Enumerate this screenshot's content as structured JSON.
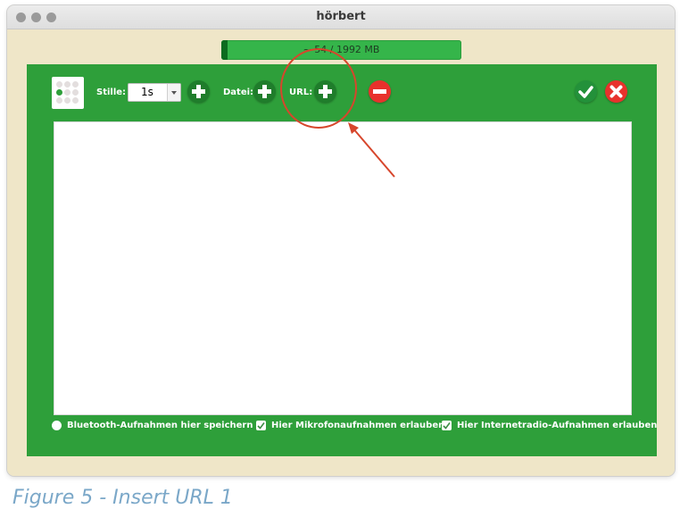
{
  "window": {
    "title": "hörbert"
  },
  "storage": {
    "label": "~ 54 / 1992 MB",
    "used_mb": 54,
    "total_mb": 1992
  },
  "toolbar": {
    "silence_label": "Stille:",
    "silence_value": "1s",
    "file_label": "Datei:",
    "url_label": "URL:"
  },
  "options": {
    "bluetooth": {
      "label": "Bluetooth-Aufnahmen hier speichern",
      "checked": false
    },
    "microphone": {
      "label": "Hier Mikrofonaufnahmen erlauben",
      "checked": true
    },
    "internetradio": {
      "label": "Hier Internetradio-Aufnahmen erlauben",
      "checked": true
    }
  },
  "caption": "Figure 5 - Insert URL 1",
  "colors": {
    "panel": "#2e9f3a",
    "accent_red": "#e8322c",
    "annotation": "#d7462c",
    "caption": "#7aa7c8"
  },
  "icons": [
    "add-silence-icon",
    "add-file-icon",
    "add-url-icon",
    "remove-icon",
    "confirm-icon",
    "cancel-icon"
  ]
}
